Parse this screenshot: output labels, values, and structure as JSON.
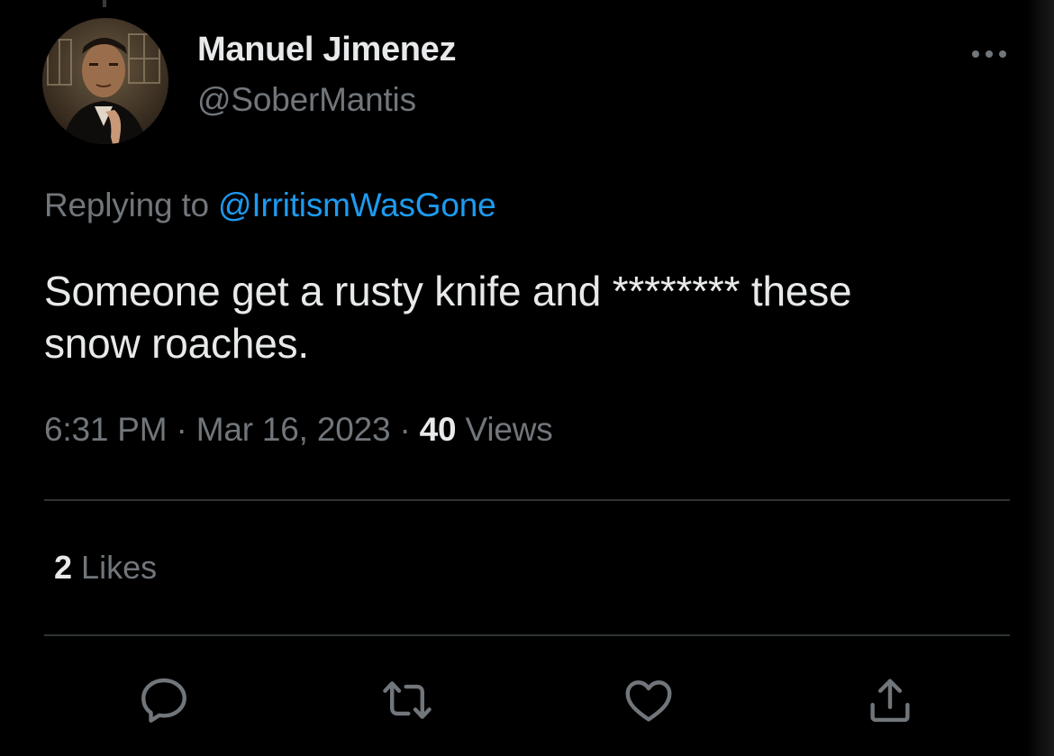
{
  "tweet": {
    "author": {
      "display_name": "Manuel Jimenez",
      "handle": "@SoberMantis",
      "avatar": "profile-photo"
    },
    "reply": {
      "prefix": "Replying to",
      "to_handle": "@IrritismWasGone"
    },
    "text_line1": "Someone get a rusty knife and ******** these",
    "text_line2": "snow roaches.",
    "meta": {
      "time": "6:31 PM",
      "separator": "·",
      "date": "Mar 16, 2023",
      "views_count": "40",
      "views_label": "Views"
    },
    "likes": {
      "count": "2",
      "label": "Likes"
    },
    "actions": {
      "reply_icon": "speech-bubble-icon",
      "retweet_icon": "retweet-icon",
      "like_icon": "heart-icon",
      "share_icon": "share-icon"
    }
  },
  "colors": {
    "background": "#000000",
    "text_primary": "#e7e9ea",
    "text_secondary": "#71767b",
    "link": "#1d9bf0",
    "divider": "#2f3336"
  }
}
